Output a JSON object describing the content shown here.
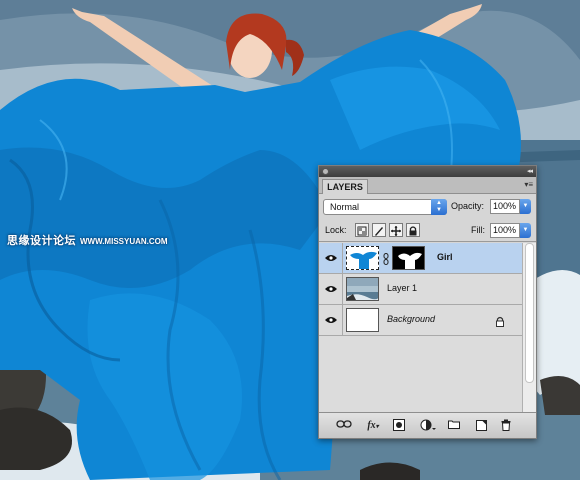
{
  "watermark": {
    "site": "思缘设计论坛",
    "url": "WWW.MISSYUAN.COM"
  },
  "panel": {
    "tab": "LAYERS",
    "blend_mode": "Normal",
    "opacity_label": "Opacity:",
    "opacity_value": "100%",
    "lock_label": "Lock:",
    "fill_label": "Fill:",
    "fill_value": "100%"
  },
  "layers": [
    {
      "name": "Girl",
      "selected": true,
      "visible": true,
      "has_mask": true
    },
    {
      "name": "Layer 1",
      "selected": false,
      "visible": true,
      "has_mask": false
    },
    {
      "name": "Background",
      "selected": false,
      "visible": true,
      "locked": true
    }
  ],
  "icons": [
    "eye-icon",
    "link-icon",
    "fx-icon",
    "mask-icon",
    "adjustment-icon",
    "folder-icon",
    "new-layer-icon",
    "trash-icon",
    "lock-icon"
  ],
  "colors": {
    "dress": "#0f86d4",
    "selection": "#b9d2ef",
    "accent": "#2b6fd1"
  }
}
